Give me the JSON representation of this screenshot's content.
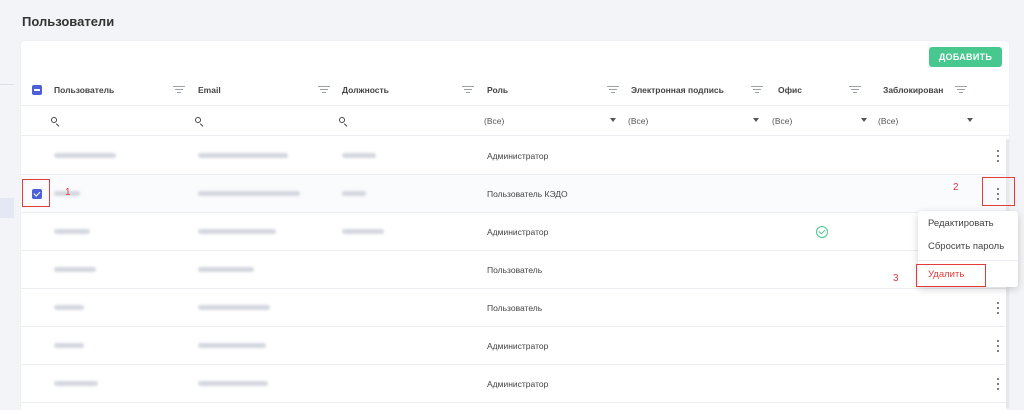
{
  "page": {
    "title": "Пользователи"
  },
  "toolbar": {
    "add_label": "ДОБАВИТЬ"
  },
  "table": {
    "columns": [
      {
        "label": "Пользователь"
      },
      {
        "label": "Email"
      },
      {
        "label": "Должность"
      },
      {
        "label": "Роль"
      },
      {
        "label": "Электронная подпись"
      },
      {
        "label": "Офис"
      },
      {
        "label": "Заблокирован"
      }
    ],
    "filters": {
      "role": "(Все)",
      "signature": "(Все)",
      "office": "(Все)",
      "blocked": "(Все)"
    },
    "rows": [
      {
        "role": "Администратор",
        "selected": false,
        "signature": false
      },
      {
        "role": "Пользователь КЭДО",
        "selected": true,
        "signature": false
      },
      {
        "role": "Администратор",
        "selected": false,
        "signature": true
      },
      {
        "role": "Пользователь",
        "selected": false,
        "signature": false
      },
      {
        "role": "Пользователь",
        "selected": false,
        "signature": false
      },
      {
        "role": "Администратор",
        "selected": false,
        "signature": false
      },
      {
        "role": "Администратор",
        "selected": false,
        "signature": false
      }
    ]
  },
  "context_menu": {
    "items": [
      {
        "label": "Редактировать"
      },
      {
        "label": "Сбросить пароль"
      },
      {
        "label": "Удалить"
      }
    ]
  },
  "annotations": {
    "step1": "1",
    "step2": "2",
    "step3": "3"
  },
  "icons": [
    "filter-icon",
    "search-icon",
    "caret-down-icon",
    "kebab-icon",
    "check-circle-icon",
    "checkbox-icon"
  ],
  "colors": {
    "accent": "#48c78e",
    "checkbox": "#4a5fd8",
    "annotation": "#e23b3b"
  }
}
